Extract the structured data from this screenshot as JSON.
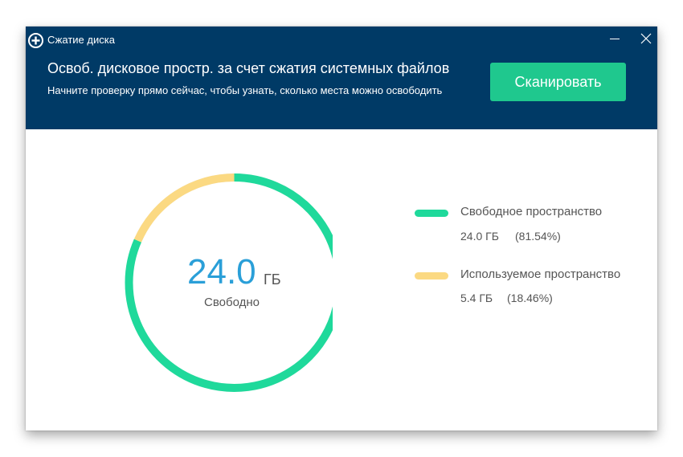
{
  "window": {
    "title": "Сжатие диска",
    "app_icon": "plus-circle-icon",
    "controls": [
      "minimize-icon",
      "close-icon"
    ]
  },
  "header": {
    "headline": "Освоб. дисковое простр. за счет сжатия системных файлов",
    "subline": "Начните проверку прямо сейчас, чтобы узнать, сколько места можно освободить",
    "scan_label": "Сканировать"
  },
  "gauge": {
    "value": "24.0",
    "unit": "ГБ",
    "caption": "Свободно"
  },
  "legend": [
    {
      "label": "Свободное пространство",
      "size": "24.0 ГБ",
      "percent": "(81.54%)",
      "color": "#1fd99b"
    },
    {
      "label": "Используемое пространство",
      "size": "5.4 ГБ",
      "percent": "(18.46%)",
      "color": "#fbd982"
    }
  ],
  "chart_data": {
    "type": "pie",
    "categories": [
      "Свободное пространство",
      "Используемое пространство"
    ],
    "values": [
      81.54,
      18.46
    ],
    "colors": [
      "#1fd99b",
      "#fbd982"
    ]
  },
  "colors": {
    "header_bg": "#003a66",
    "accent": "#1fc88e",
    "value_text": "#2a9fd8"
  }
}
